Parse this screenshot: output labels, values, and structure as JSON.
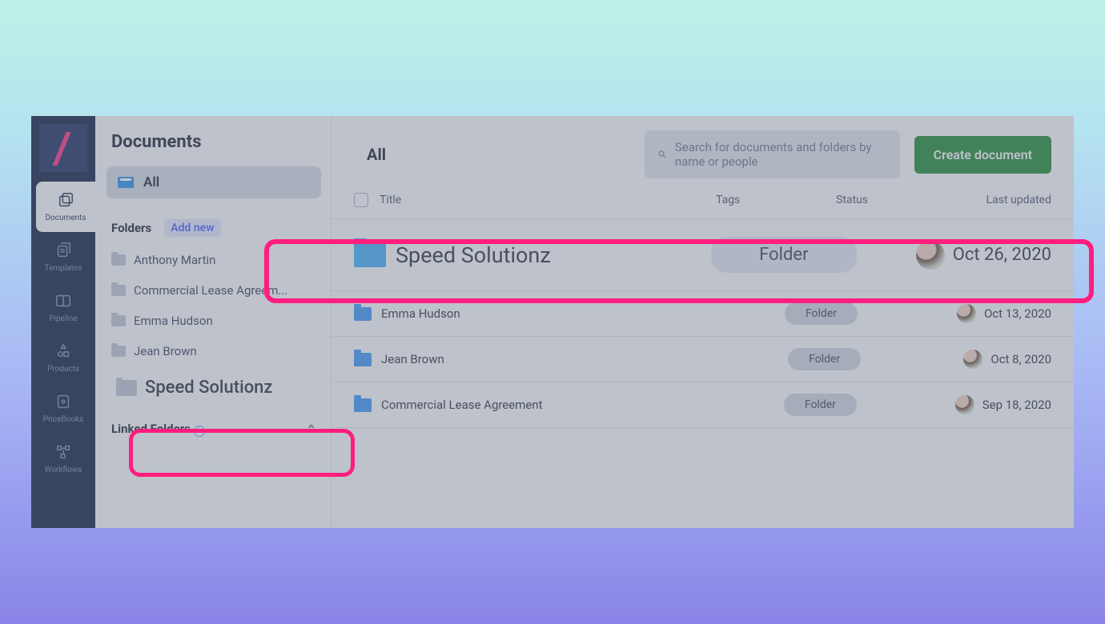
{
  "nav": {
    "items": [
      {
        "label": "Documents",
        "icon": "documents-icon",
        "active": true
      },
      {
        "label": "Templates",
        "icon": "templates-icon",
        "active": false
      },
      {
        "label": "Pipeline",
        "icon": "pipeline-icon",
        "active": false
      },
      {
        "label": "Products",
        "icon": "products-icon",
        "active": false
      },
      {
        "label": "PriceBooks",
        "icon": "pricebooks-icon",
        "active": false
      },
      {
        "label": "Workflows",
        "icon": "workflows-icon",
        "active": false
      }
    ]
  },
  "sidebar": {
    "title": "Documents",
    "all_label": "All",
    "folders_label": "Folders",
    "add_new_label": "Add new",
    "linked_folders_label": "Linked Folders",
    "folders": [
      {
        "name": "Anthony Martin"
      },
      {
        "name": "Commercial Lease Agreem..."
      },
      {
        "name": "Emma Hudson"
      },
      {
        "name": "Jean Brown"
      },
      {
        "name": "Speed Solutionz",
        "highlighted": true
      }
    ]
  },
  "main": {
    "tab": "All",
    "search_placeholder": "Search for documents and folders by name or people",
    "create_label": "Create document",
    "columns": {
      "title": "Title",
      "tags": "Tags",
      "status": "Status",
      "updated": "Last updated"
    },
    "rows": [
      {
        "name": "Speed Solutionz",
        "tag": "Folder",
        "date": "Oct 26, 2020",
        "highlighted": true
      },
      {
        "name": "Emma Hudson",
        "tag": "Folder",
        "date": "Oct 13, 2020"
      },
      {
        "name": "Jean Brown",
        "tag": "Folder",
        "date": "Oct 8, 2020"
      },
      {
        "name": "Commercial Lease Agreement",
        "tag": "Folder",
        "date": "Sep 18, 2020"
      }
    ]
  },
  "colors": {
    "accent": "#ff1e7e",
    "primary_green": "#1c8a2e",
    "folder_blue": "#3d97f7"
  }
}
